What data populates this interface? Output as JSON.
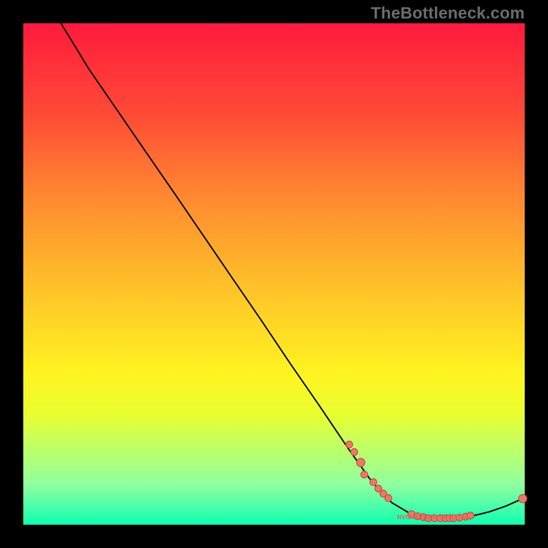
{
  "watermark": "TheBottleneck.com",
  "chart_data": {
    "type": "line",
    "title": "",
    "xlabel": "",
    "ylabel": "",
    "xlim": [
      0,
      100
    ],
    "ylim": [
      0,
      100
    ],
    "series_label": "NVIDIA GeForce MX550",
    "curve": [
      {
        "x": 7.5,
        "y": 100.0
      },
      {
        "x": 11.0,
        "y": 94.3
      },
      {
        "x": 13.0,
        "y": 91.0
      },
      {
        "x": 18.5,
        "y": 83.0
      },
      {
        "x": 24.2,
        "y": 74.7
      },
      {
        "x": 30.0,
        "y": 66.3
      },
      {
        "x": 35.8,
        "y": 57.8
      },
      {
        "x": 41.6,
        "y": 49.3
      },
      {
        "x": 47.5,
        "y": 40.7
      },
      {
        "x": 53.2,
        "y": 32.2
      },
      {
        "x": 59.0,
        "y": 23.8
      },
      {
        "x": 64.8,
        "y": 15.2
      },
      {
        "x": 69.5,
        "y": 8.6
      },
      {
        "x": 73.5,
        "y": 4.4
      },
      {
        "x": 77.2,
        "y": 2.2
      },
      {
        "x": 81.2,
        "y": 1.3
      },
      {
        "x": 85.6,
        "y": 1.3
      },
      {
        "x": 89.4,
        "y": 1.7
      },
      {
        "x": 93.0,
        "y": 2.6
      },
      {
        "x": 96.2,
        "y": 3.7
      },
      {
        "x": 99.6,
        "y": 5.2
      }
    ],
    "points": [
      {
        "x": 65.0,
        "y": 16.0,
        "r": 5
      },
      {
        "x": 66.0,
        "y": 14.5,
        "r": 5
      },
      {
        "x": 67.3,
        "y": 12.4,
        "r": 6
      },
      {
        "x": 68.0,
        "y": 10.0,
        "r": 5
      },
      {
        "x": 69.8,
        "y": 8.5,
        "r": 5
      },
      {
        "x": 70.8,
        "y": 7.2,
        "r": 5
      },
      {
        "x": 71.8,
        "y": 6.2,
        "r": 5
      },
      {
        "x": 72.8,
        "y": 5.3,
        "r": 5
      },
      {
        "x": 77.4,
        "y": 2.1,
        "r": 5
      },
      {
        "x": 78.6,
        "y": 1.7,
        "r": 5
      },
      {
        "x": 79.8,
        "y": 1.5,
        "r": 5
      },
      {
        "x": 80.8,
        "y": 1.3,
        "r": 5
      },
      {
        "x": 82.0,
        "y": 1.3,
        "r": 5
      },
      {
        "x": 83.2,
        "y": 1.3,
        "r": 5
      },
      {
        "x": 84.2,
        "y": 1.3,
        "r": 5
      },
      {
        "x": 85.0,
        "y": 1.3,
        "r": 5
      },
      {
        "x": 85.8,
        "y": 1.3,
        "r": 5
      },
      {
        "x": 87.0,
        "y": 1.4,
        "r": 5
      },
      {
        "x": 88.2,
        "y": 1.6,
        "r": 5
      },
      {
        "x": 89.2,
        "y": 1.8,
        "r": 5
      },
      {
        "x": 99.6,
        "y": 5.2,
        "r": 6
      }
    ],
    "series_watermark_anchor": {
      "x": 80.0,
      "y": 1.3
    },
    "colors": {
      "curve": "#000000",
      "dot_fill": "#e97a6a",
      "dot_stroke": "#c84f40",
      "gradient_top": "#ff1a40",
      "gradient_bottom": "#10ffb0"
    }
  }
}
